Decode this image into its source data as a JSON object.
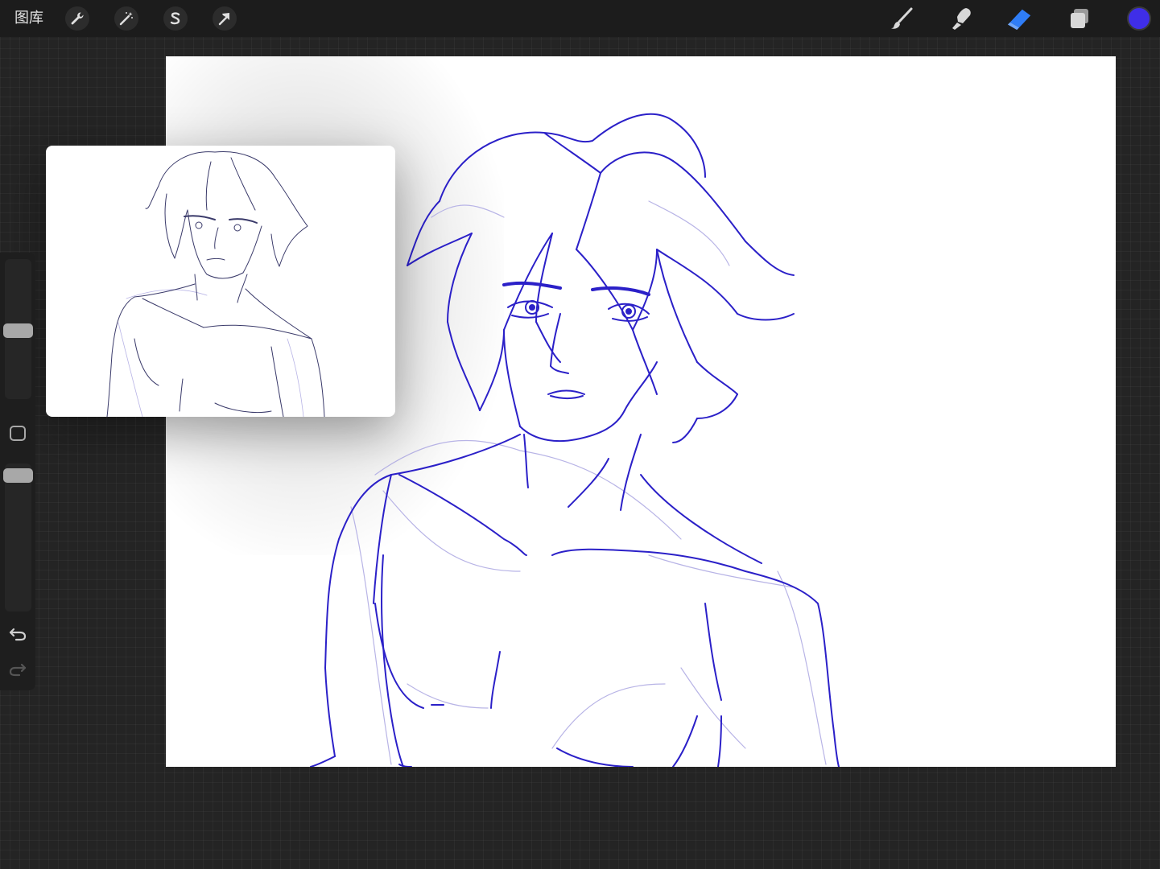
{
  "topbar": {
    "gallery_label": "图库",
    "left_tools": [
      {
        "name": "actions",
        "icon": "wrench-icon"
      },
      {
        "name": "adjustments",
        "icon": "magic-wand-icon"
      },
      {
        "name": "selection",
        "icon": "selection-s-icon"
      },
      {
        "name": "transform",
        "icon": "arrow-cursor-icon"
      }
    ],
    "right_tools": [
      {
        "name": "brush",
        "icon": "brush-icon",
        "active": false
      },
      {
        "name": "smudge",
        "icon": "smudge-icon",
        "active": false
      },
      {
        "name": "eraser",
        "icon": "eraser-icon",
        "active": true
      },
      {
        "name": "layers",
        "icon": "layers-icon",
        "active": false
      }
    ],
    "current_color": "#3f2ee8",
    "active_tool_color": "#2f7df6"
  },
  "sidebar": {
    "brush_size_level": 0.5,
    "opacity_level": 0.92,
    "modify_button": "square-icon",
    "undo": "undo-icon",
    "redo": "redo-icon"
  },
  "reference_window": {
    "content": "reference-sketch"
  },
  "canvas": {
    "stroke_color": "#2b20c8",
    "sketch_color": "#b8b4e6"
  }
}
